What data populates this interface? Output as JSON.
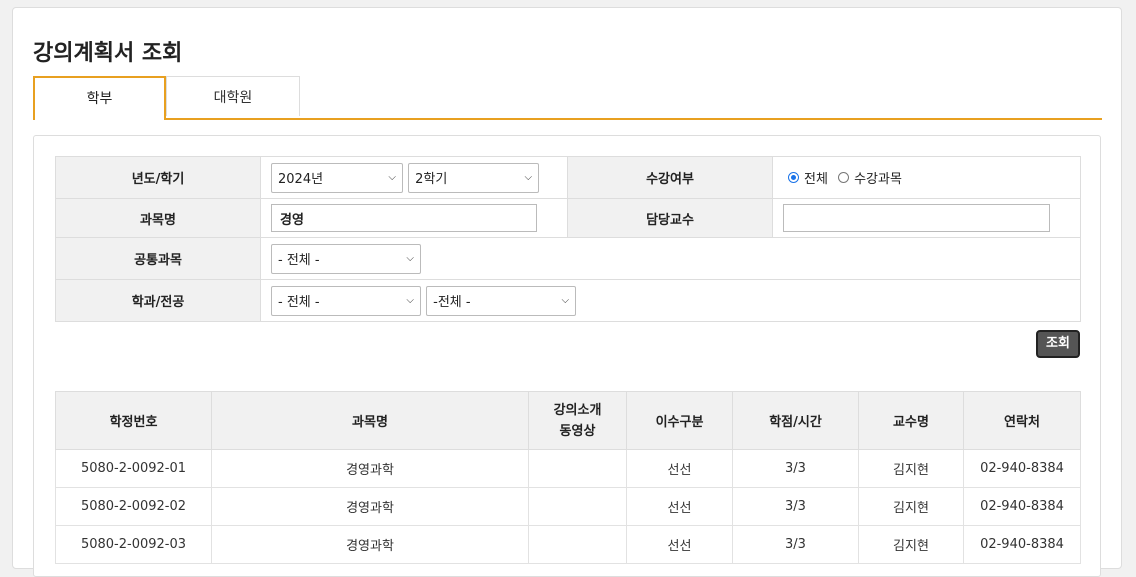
{
  "page": {
    "title": "강의계획서 조회"
  },
  "tabs": [
    {
      "label": "학부",
      "active": true
    },
    {
      "label": "대학원",
      "active": false
    }
  ],
  "accent_color": "#e8a020",
  "search": {
    "year_term_label": "년도/학기",
    "year_value": "2024년",
    "term_value": "2학기",
    "enroll_label": "수강여부",
    "radio_all": "전체",
    "radio_enrolled": "수강과목",
    "radio_selected": "전체",
    "course_label": "과목명",
    "course_value": "경영",
    "professor_label": "담당교수",
    "professor_value": "",
    "common_label": "공통과목",
    "common_value": "- 전체 -",
    "dept_label": "학과/전공",
    "dept_value": "- 전체 -",
    "major_value": "-전체 -",
    "button_label": "조회"
  },
  "results": {
    "headers": [
      "학정번호",
      "과목명",
      "강의소개\n동영상",
      "이수구분",
      "학점/시간",
      "교수명",
      "연락처"
    ],
    "rows": [
      [
        "5080-2-0092-01",
        "경영과학",
        "",
        "선선",
        "3/3",
        "김지현",
        "02-940-8384"
      ],
      [
        "5080-2-0092-02",
        "경영과학",
        "",
        "선선",
        "3/3",
        "김지현",
        "02-940-8384"
      ],
      [
        "5080-2-0092-03",
        "경영과학",
        "",
        "선선",
        "3/3",
        "김지현",
        "02-940-8384"
      ]
    ]
  }
}
